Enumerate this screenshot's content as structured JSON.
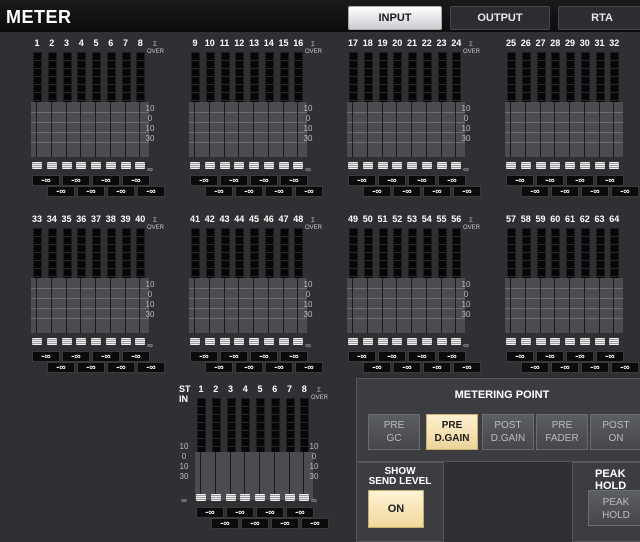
{
  "window": {
    "title": "METER"
  },
  "tabs": [
    {
      "label": "INPUT",
      "active": true
    },
    {
      "label": "OUTPUT",
      "active": false
    },
    {
      "label": "RTA",
      "active": false
    }
  ],
  "banks": [
    {
      "channels": [
        "1",
        "2",
        "3",
        "4",
        "5",
        "6",
        "7",
        "8"
      ]
    },
    {
      "channels": [
        "9",
        "10",
        "11",
        "12",
        "13",
        "14",
        "15",
        "16"
      ]
    },
    {
      "channels": [
        "17",
        "18",
        "19",
        "20",
        "21",
        "22",
        "23",
        "24"
      ]
    },
    {
      "channels": [
        "25",
        "26",
        "27",
        "28",
        "29",
        "30",
        "31",
        "32"
      ]
    },
    {
      "channels": [
        "33",
        "34",
        "35",
        "36",
        "37",
        "38",
        "39",
        "40"
      ]
    },
    {
      "channels": [
        "41",
        "42",
        "43",
        "44",
        "45",
        "46",
        "47",
        "48"
      ]
    },
    {
      "channels": [
        "49",
        "50",
        "51",
        "52",
        "53",
        "54",
        "55",
        "56"
      ]
    },
    {
      "channels": [
        "57",
        "58",
        "59",
        "60",
        "61",
        "62",
        "63",
        "64"
      ]
    }
  ],
  "st_in": {
    "label_line1": "ST",
    "label_line2": "IN",
    "channels": [
      "1",
      "2",
      "3",
      "4",
      "5",
      "6",
      "7",
      "8"
    ]
  },
  "meter_labels": {
    "over_sigma": "Σ",
    "over": "OVER"
  },
  "fader_scale": [
    "10",
    "0",
    "10",
    "30",
    "∞"
  ],
  "level_readout": "-∞",
  "metering_point": {
    "title": "METERING POINT",
    "buttons": [
      {
        "line1": "PRE",
        "line2": "GC",
        "selected": false
      },
      {
        "line1": "PRE",
        "line2": "D.GAIN",
        "selected": true
      },
      {
        "line1": "POST",
        "line2": "D.GAIN",
        "selected": false
      },
      {
        "line1": "PRE",
        "line2": "FADER",
        "selected": false
      },
      {
        "line1": "POST",
        "line2": "ON",
        "selected": false
      }
    ]
  },
  "show_send_level": {
    "title_line1": "SHOW",
    "title_line2": "SEND LEVEL",
    "button": "ON"
  },
  "peak_hold": {
    "title": "PEAK HOLD",
    "button_line1": "PEAK",
    "button_line2": "HOLD"
  },
  "colors": {
    "background": "#2f3033",
    "selected_button": "#f0d79c",
    "active_tab": "#ffffff"
  }
}
